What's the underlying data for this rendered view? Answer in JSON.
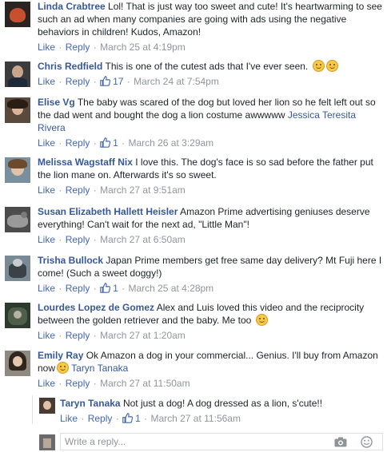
{
  "actions": {
    "like": "Like",
    "reply": "Reply",
    "sep": "·"
  },
  "comments": [
    {
      "name": "Linda Crabtree",
      "text": "Lol! That is just way too sweet and cute! It's heartwarming to see such an ad when many companies are going with ads using the negative behaviors in children! Kudos, Amazon!",
      "time": "March 25 at 4:19pm"
    },
    {
      "name": "Chris Redfield",
      "text": "This is one of the cutest ads that I've ever seen.",
      "likes": "17",
      "time": "March 24 at 7:54pm"
    },
    {
      "name": "Elise Vg",
      "text": "The baby was scared of the dog but loved her lion so he felt left out so the dad went and bought the dog a lion costume awwwww",
      "tag": "Jessica Teresita Rivera",
      "likes": "1",
      "time": "March 26 at 3:29am"
    },
    {
      "name": "Melissa Wagstaff Nix",
      "text": "I love this. The dog's face is so sad before the father put the lion mane on. Afterwards it's so sweet.",
      "time": "March 27 at 9:51am"
    },
    {
      "name": "Susan Elizabeth Hallett Heisler",
      "text": "Amazon Prime advertising geniuses deserve everything! Can't wait for the next ad, \"Little Man\"!",
      "time": "March 27 at 6:50am"
    },
    {
      "name": "Trisha Bullock",
      "text": "Japan Prime members get free same day delivery? Mt Fuji here I come! (Such a sweet doggy!)",
      "likes": "1",
      "time": "March 25 at 4:28pm"
    },
    {
      "name": "Lourdes Lopez de Gomez",
      "text": "Alex and Luis loved this video and the reciprocity between the golden retriever and the baby. Me too",
      "time": "March 27 at 1:20am"
    },
    {
      "name": "Emily Ray",
      "text": "Ok Amazon a dog in your commercial... Genius. I'll buy from Amazon now",
      "tag": "Taryn Tanaka",
      "time": "March 27 at 11:50am"
    }
  ],
  "reply": {
    "name": "Taryn Tanaka",
    "text": "Not just a dog! A dog dressed as a lion, s'cute!!",
    "likes": "1",
    "time": "March 27 at 11:56am"
  },
  "reply_box": {
    "placeholder": "Write a reply..."
  },
  "colors": {
    "link": "#365899",
    "action": "#4267b2",
    "meta": "#90949c",
    "border": "#dddfe2"
  },
  "icons": [
    "thumbs-up-icon",
    "camera-icon",
    "smiley-icon",
    "emoji-icon"
  ]
}
